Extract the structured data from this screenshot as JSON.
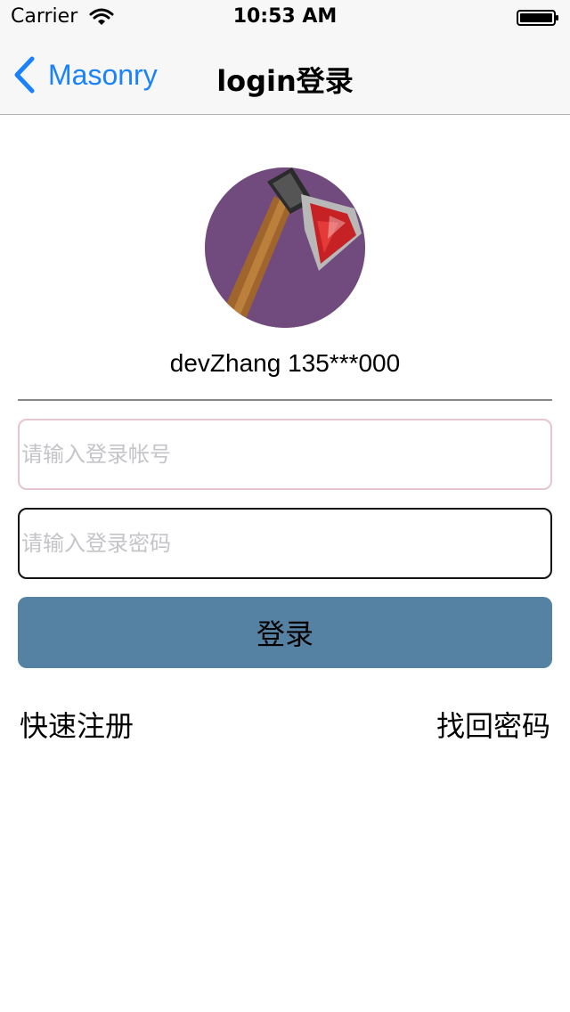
{
  "status_bar": {
    "carrier": "Carrier",
    "time": "10:53 AM",
    "wifi_icon": "wifi-icon",
    "battery_icon": "battery-full-icon"
  },
  "nav": {
    "back_label": "Masonry",
    "back_icon": "chevron-left-icon",
    "title": "login登录",
    "accent_color": "#1a82fb"
  },
  "profile": {
    "avatar_icon": "axe-avatar",
    "username": "devZhang 135***000"
  },
  "form": {
    "account_placeholder": "请输入登录帐号",
    "account_value": "",
    "password_placeholder": "请输入登录密码",
    "password_value": "",
    "login_label": "登录",
    "login_button_color": "#5581a2"
  },
  "links": {
    "register": "快速注册",
    "forgot_password": "找回密码"
  }
}
